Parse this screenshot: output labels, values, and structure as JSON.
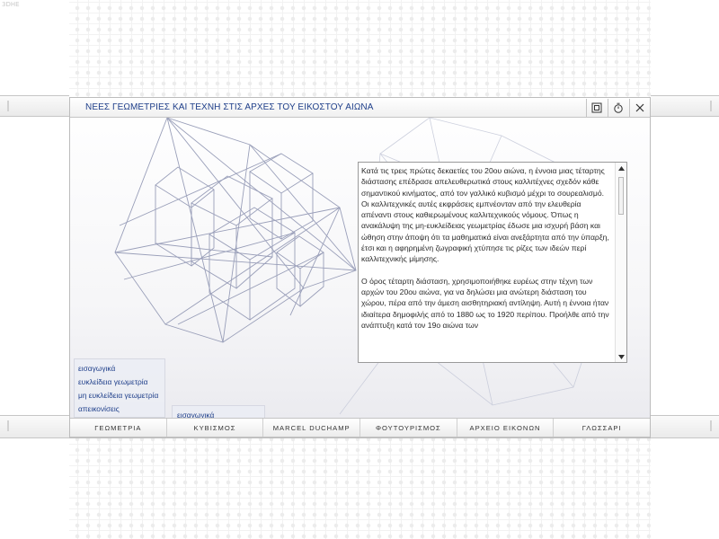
{
  "corner_label": "3DHE",
  "window": {
    "title": "ΝΕΕΣ ΓΕΩΜΕΤΡΙΕΣ ΚΑΙ ΤΕΧΝΗ ΣΤΙΣ ΑΡΧΕΣ ΤΟΥ ΕΙΚΟΣΤΟΥ ΑΙΩΝΑ",
    "buttons": [
      {
        "name": "fullscreen-icon"
      },
      {
        "name": "timer-icon"
      },
      {
        "name": "close-icon"
      }
    ]
  },
  "text_panel": {
    "paragraphs": [
      "Κατά τις τρεις πρώτες δεκαετίες του 20ου αιώνα, η έννοια μιας τέταρτης διάστασης επέδρασε απελευθερωτικά στους καλλιτέχνες σχεδόν κάθε σημαντικού κινήματος, από τον γαλλικό κυβισμό μέχρι το σουρεαλισμό. Οι καλλιτεχνικές αυτές εκφράσεις εμπνέονταν από την ελευθερία απέναντι στους καθιερωμένους καλλιτεχνικούς νόμους. Όπως η ανακάλυψη της μη-ευκλείδειας γεωμετρίας έδωσε μια ισχυρή βάση και ώθηση στην άποψη ότι τα μαθηματικά είναι ανεξάρτητα από την ύπαρξη, έτσι και η αφηρημένη ζωγραφική χτύπησε τις ρίζες των ιδεών περί καλλιτεχνικής μίμησης.",
      "Ο όρος τέταρτη διάσταση, χρησιμοποιήθηκε ευρέως στην τέχνη των αρχών του 20ου αιώνα, για να δηλώσει μια ανώτερη διάσταση του χώρου, πέρα από την άμεση αισθητηριακή αντίληψη. Αυτή η έννοια ήταν ιδιαίτερα δημοφιλής από το 1880 ως το 1920 περίπου. Προήλθε από την ανάπτυξη κατά τον 19ο αιώνα των"
    ]
  },
  "submenu": {
    "items": [
      "εισαγωγικά",
      "ευκλείδεια γεωμετρία",
      "μη ευκλείδεια γεωμετρία",
      "απεικονίσεις"
    ]
  },
  "submenu2": {
    "items": [
      "εισαγωγικά"
    ]
  },
  "navbar": {
    "items": [
      "ΓΕΩΜΕΤΡΙΑ",
      "ΚΥΒΙΣΜΟΣ",
      "MARCEL DUCHAMP",
      "ΦΟΥΤΟΥΡΙΣΜΟΣ",
      "ΑΡΧΕΙΟ ΕΙΚΟΝΩΝ",
      "ΓΛΩΣΣΑΡΙ"
    ]
  },
  "colors": {
    "title_text": "#1f3f8a",
    "menu_text": "#1f3f8a",
    "line_art": "#8f95b2"
  }
}
